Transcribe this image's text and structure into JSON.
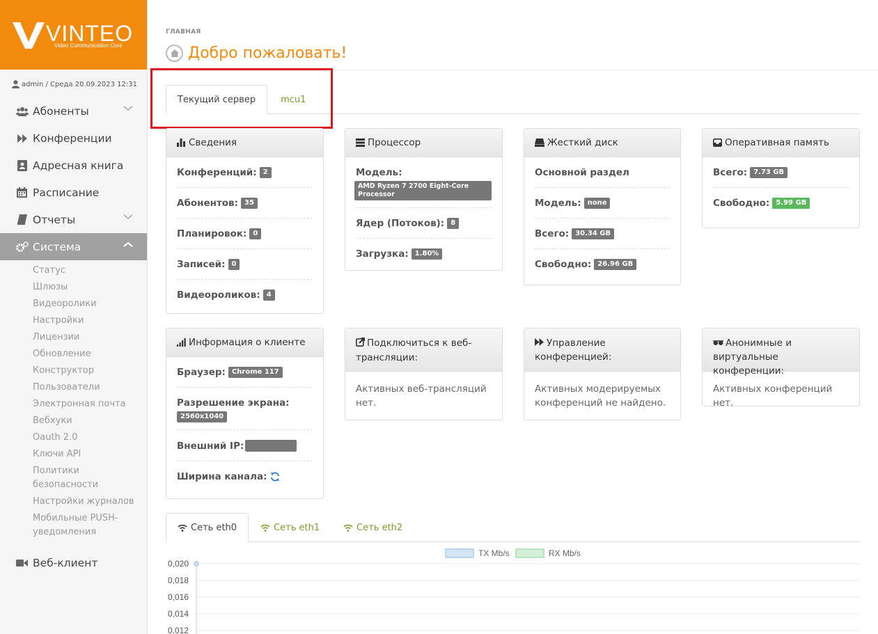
{
  "brand": {
    "name": "VINTEO",
    "tagline": "Video Communication Core",
    "color": "#f28a0d"
  },
  "user": {
    "line": "admin / Среда 20.09.2023 12:31"
  },
  "sidebar": {
    "items": [
      {
        "label": "Абоненты",
        "icon": "users-icon",
        "chevron": "down"
      },
      {
        "label": "Конференции",
        "icon": "fast-forward-icon"
      },
      {
        "label": "Адресная книга",
        "icon": "address-book-icon"
      },
      {
        "label": "Расписание",
        "icon": "calendar-icon"
      },
      {
        "label": "Отчеты",
        "icon": "book-icon",
        "chevron": "down"
      },
      {
        "label": "Система",
        "icon": "cogs-icon",
        "chevron": "up",
        "active": true
      }
    ],
    "system_sub": [
      "Статус",
      "Шлюзы",
      "Видеоролики",
      "Настройки",
      "Лицензии",
      "Обновление",
      "Конструктор",
      "Пользователи",
      "Электронная почта",
      "Вебхуки",
      "Oauth 2.0",
      "Ключи API",
      "Политики безопасности",
      "Настройки журналов",
      "Мобильные PUSH-уведомления"
    ],
    "web_client": {
      "label": "Веб-клиент",
      "icon": "video-camera-icon"
    }
  },
  "header": {
    "breadcrumb": "ГЛАВНАЯ",
    "title": "Добро пожаловать!"
  },
  "server_tabs": [
    {
      "label": "Текущий сервер",
      "active": true
    },
    {
      "label": "mcu1"
    }
  ],
  "panels": {
    "info": {
      "title": "Сведения",
      "rows": [
        {
          "label": "Конференций:",
          "value": "2"
        },
        {
          "label": "Абонентов:",
          "value": "35"
        },
        {
          "label": "Планировок:",
          "value": "0"
        },
        {
          "label": "Записей:",
          "value": "0"
        },
        {
          "label": "Видеороликов:",
          "value": "4"
        }
      ]
    },
    "cpu": {
      "title": "Процессор",
      "model_label": "Модель:",
      "model_value": "AMD Ryzen 7 2700 Eight-Core Processor",
      "cores_label": "Ядер (Потоков):",
      "cores_value": "8",
      "load_label": "Загрузка:",
      "load_value": "1.80%"
    },
    "disk": {
      "title": "Жесткий диск",
      "section": "Основной раздел",
      "model_label": "Модель:",
      "model_value": "none",
      "total_label": "Всего:",
      "total_value": "30.34 GB",
      "free_label": "Свободно:",
      "free_value": "26.96 GB"
    },
    "ram": {
      "title": "Оперативная память",
      "total_label": "Всего:",
      "total_value": "7.73 GB",
      "free_label": "Свободно:",
      "free_value": "5.99 GB"
    },
    "client": {
      "title": "Информация о клиенте",
      "browser_label": "Браузер:",
      "browser_value": "Chrome 117",
      "resolution_label": "Разрешение экрана:",
      "resolution_value": "2560x1040",
      "ip_label": "Внешний IP:",
      "ip_value": "",
      "bandwidth_label": "Ширина канала:"
    },
    "web": {
      "title": "Подключиться к веб-трансляции:",
      "text": "Активных веб-трансляций нет."
    },
    "manage": {
      "title": "Управление конференцией:",
      "text": "Активных модерируемых конференций не найдено."
    },
    "anon": {
      "title": "Анонимные и виртуальные конференции:",
      "text": "Активных конференций нет."
    }
  },
  "net_tabs": [
    {
      "label": "Сеть eth0",
      "active": true
    },
    {
      "label": "Сеть eth1"
    },
    {
      "label": "Сеть eth2"
    }
  ],
  "colors": {
    "link_green": "#7a9e2c",
    "highlight_red": "#e0141f"
  },
  "chart_data": {
    "type": "line",
    "series": [
      {
        "name": "TX Mb/s",
        "color": "#a8cbe8",
        "values": [
          0.02
        ]
      },
      {
        "name": "RX Mb/s",
        "color": "#a8dfb0",
        "values": []
      }
    ],
    "ylim": [
      0,
      0.02
    ],
    "yticks": [
      "0,020",
      "0,018",
      "0,016",
      "0,014",
      "0,012"
    ],
    "legend": "top-center",
    "grid": true
  }
}
